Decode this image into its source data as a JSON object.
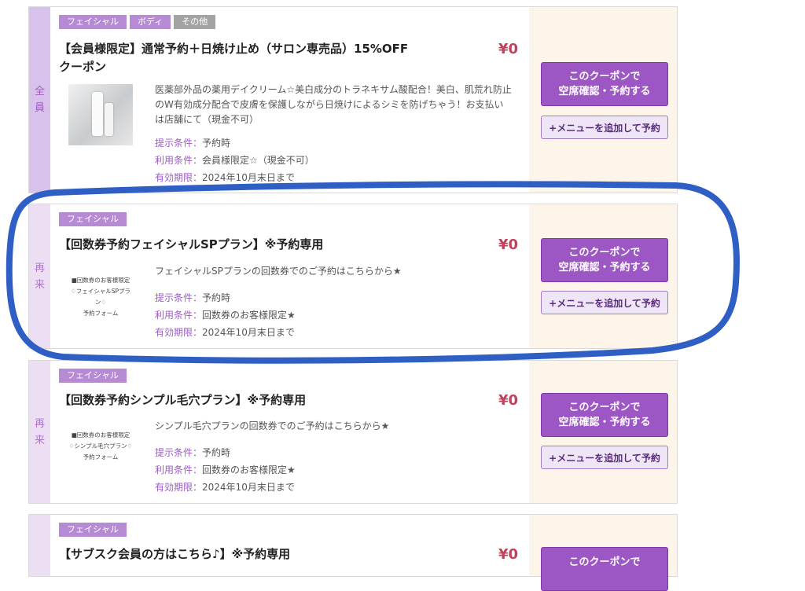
{
  "coupons": [
    {
      "target": [
        "全",
        "員"
      ],
      "tags": [
        "フェイシャル",
        "ボディ",
        "その他"
      ],
      "title_line1": "【会員様限定】通常予約＋日焼け止め（サロン専売品）15%OFF",
      "title_line2": "クーポン",
      "price": "¥0",
      "description": "医薬部外品の薬用デイクリーム☆美白成分のトラネキサム酸配合！美白、肌荒れ防止のW有効成分配合で皮膚を保護しながら日焼けによるシミを防げちゃう！お支払いは店舗にて（現金不可）",
      "conditions": [
        {
          "label": "提示条件：",
          "value": "予約時"
        },
        {
          "label": "利用条件：",
          "value": "会員様限定☆（現金不可）"
        },
        {
          "label": "有効期限：",
          "value": "2024年10月末日まで"
        }
      ],
      "book_button": [
        "このクーポンで",
        "空席確認・予約する"
      ],
      "add_menu_button": "+メニューを追加して予約"
    },
    {
      "target": [
        "再",
        "来"
      ],
      "tags": [
        "フェイシャル"
      ],
      "title": "【回数券予約フェイシャルSPプラン】※予約専用",
      "price": "¥0",
      "description": "フェイシャルSPプランの回数券でのご予約はこちらから★",
      "image_text": [
        "■回数券のお客様限定",
        "♢フェイシャルSPプラン♢",
        "予約フォーム"
      ],
      "conditions": [
        {
          "label": "提示条件：",
          "value": "予約時"
        },
        {
          "label": "利用条件：",
          "value": "回数券のお客様限定★"
        },
        {
          "label": "有効期限：",
          "value": "2024年10月末日まで"
        }
      ],
      "book_button": [
        "このクーポンで",
        "空席確認・予約する"
      ],
      "add_menu_button": "+メニューを追加して予約"
    },
    {
      "target": [
        "再",
        "来"
      ],
      "tags": [
        "フェイシャル"
      ],
      "title": "【回数券予約シンプル毛穴プラン】※予約専用",
      "price": "¥0",
      "description": "シンプル毛穴プランの回数券でのご予約はこちらから★",
      "image_text": [
        "■回数券のお客様限定",
        "♢シンプル毛穴プラン♢",
        "予約フォーム"
      ],
      "conditions": [
        {
          "label": "提示条件：",
          "value": "予約時"
        },
        {
          "label": "利用条件：",
          "value": "回数券のお客様限定★"
        },
        {
          "label": "有効期限：",
          "value": "2024年10月末日まで"
        }
      ],
      "book_button": [
        "このクーポンで",
        "空席確認・予約する"
      ],
      "add_menu_button": "+メニューを追加して予約"
    },
    {
      "tags": [
        "フェイシャル"
      ],
      "title": "【サブスク会員の方はこちら♪】※予約専用",
      "price": "¥0",
      "book_button": [
        "このクーポンで"
      ]
    }
  ],
  "colors": {
    "accent_purple": "#9d57c4",
    "price_red": "#c0425b",
    "annotation_blue": "#2f5fc4"
  }
}
